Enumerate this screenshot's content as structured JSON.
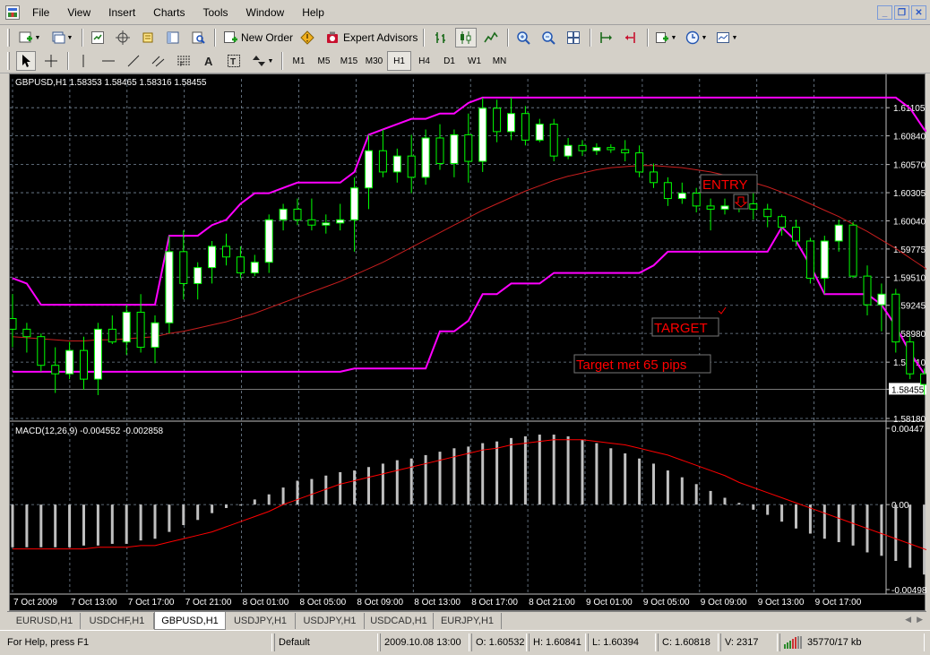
{
  "menu": {
    "items": [
      "File",
      "View",
      "Insert",
      "Charts",
      "Tools",
      "Window",
      "Help"
    ]
  },
  "toolbar": {
    "new_order_label": "New Order",
    "expert_advisors_label": "Expert Advisors",
    "timeframes": [
      "M1",
      "M5",
      "M15",
      "M30",
      "H1",
      "H4",
      "D1",
      "W1",
      "MN"
    ],
    "active_timeframe": "H1"
  },
  "chart": {
    "header": "GBPUSD,H1  1.58353 1.58465 1.58316 1.58455",
    "macd_header": "MACD(12,26,9) -0.004552 -0.002858",
    "price_ticks": [
      "1.61105",
      "1.60840",
      "1.60570",
      "1.60305",
      "1.60040",
      "1.59775",
      "1.59510",
      "1.59245",
      "1.58980",
      "1.58710",
      "1.58455",
      "1.58180"
    ],
    "current_price": "1.58455",
    "macd_ticks": [
      "0.00447",
      "0.00",
      "-0.00498"
    ],
    "time_ticks": [
      "7 Oct 2009",
      "7 Oct 13:00",
      "7 Oct 17:00",
      "7 Oct 21:00",
      "8 Oct 01:00",
      "8 Oct 05:00",
      "8 Oct 09:00",
      "8 Oct 13:00",
      "8 Oct 17:00",
      "8 Oct 21:00",
      "9 Oct 01:00",
      "9 Oct 05:00",
      "9 Oct 09:00",
      "9 Oct 13:00",
      "9 Oct 17:00"
    ],
    "annotations": {
      "entry": "ENTRY",
      "target": "TARGET",
      "target_met": "Target met 65 pips"
    },
    "colors": {
      "bull_candle": "#ffffff",
      "bear_candle": "#000000",
      "wick": "#00ff00",
      "channel": "#ff00ff",
      "moving_average": "#c81e1e",
      "annotation": "#ff0000",
      "macd_histogram": "#c0c0c0",
      "macd_signal": "#ff0000",
      "grid": "#778899"
    }
  },
  "chart_data": {
    "type": "candlestick",
    "symbol": "GBPUSD,H1",
    "ylim": [
      1.5818,
      1.6125
    ],
    "candles": [
      {
        "o": 1.5912,
        "h": 1.5935,
        "l": 1.5885,
        "c": 1.5902
      },
      {
        "o": 1.5902,
        "h": 1.5908,
        "l": 1.588,
        "c": 1.5895
      },
      {
        "o": 1.5895,
        "h": 1.5898,
        "l": 1.5862,
        "c": 1.5868
      },
      {
        "o": 1.5868,
        "h": 1.5885,
        "l": 1.5842,
        "c": 1.586
      },
      {
        "o": 1.586,
        "h": 1.589,
        "l": 1.5855,
        "c": 1.5882
      },
      {
        "o": 1.5882,
        "h": 1.5895,
        "l": 1.5845,
        "c": 1.5855
      },
      {
        "o": 1.5855,
        "h": 1.5908,
        "l": 1.584,
        "c": 1.5902
      },
      {
        "o": 1.5902,
        "h": 1.5915,
        "l": 1.5888,
        "c": 1.589
      },
      {
        "o": 1.589,
        "h": 1.5925,
        "l": 1.5878,
        "c": 1.5918
      },
      {
        "o": 1.5918,
        "h": 1.5935,
        "l": 1.588,
        "c": 1.5885
      },
      {
        "o": 1.5885,
        "h": 1.5915,
        "l": 1.587,
        "c": 1.5908
      },
      {
        "o": 1.5908,
        "h": 1.599,
        "l": 1.5898,
        "c": 1.5975
      },
      {
        "o": 1.5975,
        "h": 1.5995,
        "l": 1.593,
        "c": 1.5945
      },
      {
        "o": 1.5945,
        "h": 1.5965,
        "l": 1.593,
        "c": 1.596
      },
      {
        "o": 1.596,
        "h": 1.5985,
        "l": 1.5945,
        "c": 1.598
      },
      {
        "o": 1.598,
        "h": 1.5992,
        "l": 1.5962,
        "c": 1.597
      },
      {
        "o": 1.597,
        "h": 1.598,
        "l": 1.595,
        "c": 1.5955
      },
      {
        "o": 1.5955,
        "h": 1.5972,
        "l": 1.5952,
        "c": 1.5965
      },
      {
        "o": 1.5965,
        "h": 1.601,
        "l": 1.5955,
        "c": 1.6005
      },
      {
        "o": 1.6005,
        "h": 1.602,
        "l": 1.5995,
        "c": 1.6015
      },
      {
        "o": 1.6015,
        "h": 1.6025,
        "l": 1.6,
        "c": 1.6005
      },
      {
        "o": 1.6005,
        "h": 1.6025,
        "l": 1.5995,
        "c": 1.6
      },
      {
        "o": 1.6,
        "h": 1.601,
        "l": 1.5992,
        "c": 1.6002
      },
      {
        "o": 1.6002,
        "h": 1.602,
        "l": 1.5995,
        "c": 1.6005
      },
      {
        "o": 1.6005,
        "h": 1.6045,
        "l": 1.5975,
        "c": 1.6035
      },
      {
        "o": 1.6035,
        "h": 1.6085,
        "l": 1.6015,
        "c": 1.607
      },
      {
        "o": 1.607,
        "h": 1.609,
        "l": 1.6045,
        "c": 1.605
      },
      {
        "o": 1.605,
        "h": 1.6072,
        "l": 1.604,
        "c": 1.6065
      },
      {
        "o": 1.6065,
        "h": 1.6085,
        "l": 1.603,
        "c": 1.6045
      },
      {
        "o": 1.6045,
        "h": 1.609,
        "l": 1.6038,
        "c": 1.6082
      },
      {
        "o": 1.6082,
        "h": 1.6095,
        "l": 1.6052,
        "c": 1.6058
      },
      {
        "o": 1.6058,
        "h": 1.609,
        "l": 1.6045,
        "c": 1.6085
      },
      {
        "o": 1.6085,
        "h": 1.6105,
        "l": 1.604,
        "c": 1.606
      },
      {
        "o": 1.606,
        "h": 1.612,
        "l": 1.605,
        "c": 1.611
      },
      {
        "o": 1.611,
        "h": 1.6118,
        "l": 1.6078,
        "c": 1.6088
      },
      {
        "o": 1.6088,
        "h": 1.612,
        "l": 1.608,
        "c": 1.6105
      },
      {
        "o": 1.6105,
        "h": 1.6112,
        "l": 1.6075,
        "c": 1.608
      },
      {
        "o": 1.608,
        "h": 1.61,
        "l": 1.6078,
        "c": 1.6095
      },
      {
        "o": 1.6095,
        "h": 1.61,
        "l": 1.606,
        "c": 1.6065
      },
      {
        "o": 1.6065,
        "h": 1.6082,
        "l": 1.6062,
        "c": 1.6075
      },
      {
        "o": 1.6075,
        "h": 1.608,
        "l": 1.6065,
        "c": 1.607
      },
      {
        "o": 1.607,
        "h": 1.6077,
        "l": 1.6066,
        "c": 1.6073
      },
      {
        "o": 1.6073,
        "h": 1.6076,
        "l": 1.6068,
        "c": 1.6071
      },
      {
        "o": 1.6071,
        "h": 1.608,
        "l": 1.606,
        "c": 1.6068
      },
      {
        "o": 1.6068,
        "h": 1.6075,
        "l": 1.6045,
        "c": 1.605
      },
      {
        "o": 1.605,
        "h": 1.6058,
        "l": 1.6035,
        "c": 1.604
      },
      {
        "o": 1.604,
        "h": 1.6045,
        "l": 1.6018,
        "c": 1.6025
      },
      {
        "o": 1.6025,
        "h": 1.604,
        "l": 1.602,
        "c": 1.603
      },
      {
        "o": 1.603,
        "h": 1.6035,
        "l": 1.6012,
        "c": 1.6018
      },
      {
        "o": 1.6018,
        "h": 1.6025,
        "l": 1.5995,
        "c": 1.6015
      },
      {
        "o": 1.6015,
        "h": 1.6025,
        "l": 1.601,
        "c": 1.6018
      },
      {
        "o": 1.6018,
        "h": 1.6028,
        "l": 1.6012,
        "c": 1.602
      },
      {
        "o": 1.602,
        "h": 1.603,
        "l": 1.6005,
        "c": 1.6015
      },
      {
        "o": 1.6015,
        "h": 1.602,
        "l": 1.5998,
        "c": 1.6008
      },
      {
        "o": 1.6008,
        "h": 1.601,
        "l": 1.599,
        "c": 1.5998
      },
      {
        "o": 1.5998,
        "h": 1.6005,
        "l": 1.598,
        "c": 1.5985
      },
      {
        "o": 1.5985,
        "h": 1.5988,
        "l": 1.5945,
        "c": 1.595
      },
      {
        "o": 1.595,
        "h": 1.599,
        "l": 1.5935,
        "c": 1.5985
      },
      {
        "o": 1.5985,
        "h": 1.6005,
        "l": 1.5975,
        "c": 1.6
      },
      {
        "o": 1.6,
        "h": 1.6003,
        "l": 1.595,
        "c": 1.5952
      },
      {
        "o": 1.5952,
        "h": 1.5962,
        "l": 1.5915,
        "c": 1.5925
      },
      {
        "o": 1.5925,
        "h": 1.5945,
        "l": 1.59,
        "c": 1.5935
      },
      {
        "o": 1.5935,
        "h": 1.594,
        "l": 1.588,
        "c": 1.589
      },
      {
        "o": 1.589,
        "h": 1.5895,
        "l": 1.5855,
        "c": 1.586
      },
      {
        "o": 1.586,
        "h": 1.5865,
        "l": 1.584,
        "c": 1.585
      },
      {
        "o": 1.585,
        "h": 1.5852,
        "l": 1.5825,
        "c": 1.5832
      },
      {
        "o": 1.5832,
        "h": 1.585,
        "l": 1.583,
        "c": 1.5846
      }
    ],
    "channel_upper": [
      1.595,
      1.5945,
      1.5925,
      1.5925,
      1.5925,
      1.5925,
      1.5925,
      1.5925,
      1.5925,
      1.5925,
      1.5925,
      1.599,
      1.599,
      1.599,
      1.6,
      1.6005,
      1.602,
      1.603,
      1.603,
      1.6035,
      1.604,
      1.604,
      1.604,
      1.604,
      1.605,
      1.6085,
      1.609,
      1.6095,
      1.61,
      1.61,
      1.6105,
      1.6105,
      1.6115,
      1.612,
      1.612,
      1.612,
      1.612,
      1.612,
      1.612,
      1.612,
      1.612,
      1.612,
      1.612,
      1.612,
      1.612,
      1.612,
      1.612,
      1.612,
      1.612,
      1.612,
      1.612,
      1.612,
      1.612,
      1.612,
      1.612,
      1.612,
      1.612,
      1.612,
      1.612,
      1.612,
      1.612,
      1.612,
      1.612,
      1.611,
      1.609,
      1.608,
      1.6078
    ],
    "channel_lower": [
      1.5862,
      1.5862,
      1.5862,
      1.5862,
      1.5862,
      1.5862,
      1.5862,
      1.5862,
      1.5862,
      1.5862,
      1.5862,
      1.5862,
      1.5862,
      1.5862,
      1.5862,
      1.5862,
      1.5862,
      1.5862,
      1.5862,
      1.5862,
      1.5862,
      1.5862,
      1.5862,
      1.5862,
      1.5865,
      1.5865,
      1.5865,
      1.5865,
      1.5865,
      1.5865,
      1.59,
      1.59,
      1.591,
      1.5935,
      1.5935,
      1.5945,
      1.5945,
      1.5945,
      1.5955,
      1.5955,
      1.5955,
      1.5955,
      1.5955,
      1.5955,
      1.5955,
      1.5962,
      1.5975,
      1.5975,
      1.5975,
      1.5975,
      1.5975,
      1.5975,
      1.5975,
      1.5975,
      1.5998,
      1.5985,
      1.5962,
      1.5935,
      1.5935,
      1.5935,
      1.5935,
      1.5925,
      1.5905,
      1.588,
      1.586,
      1.584,
      1.5832
    ],
    "moving_average": [
      1.5895,
      1.5894,
      1.5893,
      1.5892,
      1.5891,
      1.5891,
      1.5892,
      1.5892,
      1.5893,
      1.5894,
      1.5895,
      1.5898,
      1.59,
      1.5903,
      1.5906,
      1.5909,
      1.5913,
      1.5917,
      1.5922,
      1.5927,
      1.5932,
      1.5937,
      1.5942,
      1.5947,
      1.5953,
      1.5959,
      1.5965,
      1.5972,
      1.5979,
      1.5986,
      1.5993,
      1.6,
      1.6007,
      1.6014,
      1.602,
      1.6026,
      1.6032,
      1.6037,
      1.6042,
      1.6046,
      1.6049,
      1.6052,
      1.6054,
      1.6055,
      1.6056,
      1.6056,
      1.6055,
      1.6054,
      1.6052,
      1.605,
      1.6047,
      1.6044,
      1.604,
      1.6036,
      1.6031,
      1.6026,
      1.602,
      1.6014,
      1.6008,
      1.6001,
      1.5994,
      1.5986,
      1.5978,
      1.5969,
      1.596,
      1.595,
      1.594
    ],
    "macd": {
      "ylim": [
        -0.00498,
        0.00447
      ],
      "histogram": [
        -0.0025,
        -0.0025,
        -0.0025,
        -0.0025,
        -0.0025,
        -0.0024,
        -0.0024,
        -0.0023,
        -0.0023,
        -0.0021,
        -0.002,
        -0.0016,
        -0.0012,
        -0.0009,
        -0.0005,
        -0.0002,
        0.0,
        0.0003,
        0.0006,
        0.001,
        0.0014,
        0.0015,
        0.0017,
        0.0019,
        0.002,
        0.0022,
        0.0024,
        0.0026,
        0.0027,
        0.0029,
        0.0031,
        0.0033,
        0.0034,
        0.0036,
        0.0037,
        0.0039,
        0.004,
        0.0041,
        0.0041,
        0.004,
        0.0038,
        0.0036,
        0.0033,
        0.003,
        0.0027,
        0.0024,
        0.002,
        0.0016,
        0.0012,
        0.0008,
        0.0004,
        0.0001,
        -0.0003,
        -0.0006,
        -0.001,
        -0.0014,
        -0.0017,
        -0.002,
        -0.0022,
        -0.0024,
        -0.0028,
        -0.003,
        -0.0033,
        -0.0037,
        -0.0041,
        -0.0044,
        -0.0046
      ],
      "signal": [
        -0.0026,
        -0.0026,
        -0.0026,
        -0.0026,
        -0.0026,
        -0.0026,
        -0.0025,
        -0.0025,
        -0.0025,
        -0.0024,
        -0.0024,
        -0.0022,
        -0.002,
        -0.0018,
        -0.0016,
        -0.0013,
        -0.001,
        -0.0007,
        -0.0004,
        0.0,
        0.0003,
        0.0006,
        0.0009,
        0.0012,
        0.0014,
        0.0016,
        0.0018,
        0.002,
        0.0022,
        0.0024,
        0.0026,
        0.0028,
        0.003,
        0.0032,
        0.0033,
        0.0035,
        0.0036,
        0.0037,
        0.0038,
        0.0038,
        0.0038,
        0.0037,
        0.0036,
        0.0035,
        0.0033,
        0.0031,
        0.0029,
        0.0026,
        0.0023,
        0.002,
        0.0017,
        0.0013,
        0.001,
        0.0007,
        0.0004,
        0.0001,
        -0.0002,
        -0.0005,
        -0.0008,
        -0.0011,
        -0.0014,
        -0.0017,
        -0.002,
        -0.0023,
        -0.0026,
        -0.0029,
        -0.0033
      ]
    }
  },
  "tabs": [
    "EURUSD,H1",
    "USDCHF,H1",
    "GBPUSD,H1",
    "USDJPY,H1",
    "USDJPY,H1",
    "USDCAD,H1",
    "EURJPY,H1"
  ],
  "active_tab": "GBPUSD,H1",
  "status": {
    "help": "For Help, press F1",
    "profile": "Default",
    "datetime": "2009.10.08 13:00",
    "open": "O: 1.60532",
    "high": "H: 1.60841",
    "low": "L: 1.60394",
    "close": "C: 1.60818",
    "volume": "V: 2317",
    "traffic": "35770/17 kb"
  }
}
